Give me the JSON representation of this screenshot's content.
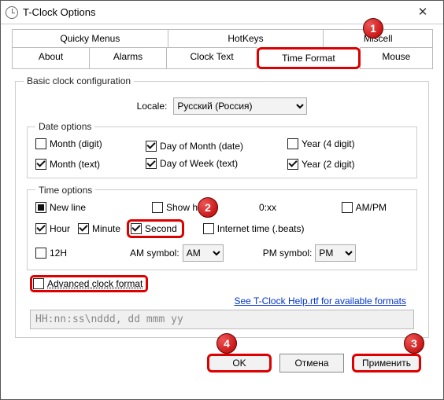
{
  "window": {
    "title": "T-Clock Options"
  },
  "tabs_top": [
    "Quicky Menus",
    "HotKeys",
    "Miscell"
  ],
  "tabs_bottom": [
    "About",
    "Alarms",
    "Clock Text",
    "Time Format",
    "Mouse"
  ],
  "group_basic": "Basic clock configuration",
  "locale_label": "Locale:",
  "locale_value": "Русский (Россия)",
  "group_date": "Date options",
  "date_options": {
    "month_digit": "Month (digit)",
    "month_text": "Month (text)",
    "day_of_month": "Day of Month (date)",
    "day_of_week": "Day of Week (text)",
    "year4": "Year (4 digit)",
    "year2": "Year (2 digit)"
  },
  "group_time": "Time options",
  "time_options": {
    "new_line": "New line",
    "show_hours": "Show h",
    "show_hours_suffix": "0:xx",
    "ampm": "AM/PM",
    "hour": "Hour",
    "minute": "Minute",
    "second": "Second",
    "internet_time": "Internet time (.beats)",
    "h12": "12H",
    "am_symbol_lbl": "AM symbol:",
    "am_symbol": "AM",
    "pm_symbol_lbl": "PM symbol:",
    "pm_symbol": "PM"
  },
  "advanced_label": "Advanced clock format",
  "help_link": "See T-Clock Help.rtf for available formats",
  "format_string": "HH:nn:ss\\nddd, dd mmm yy",
  "buttons": {
    "ok": "OK",
    "cancel": "Отмена",
    "apply": "Применить"
  },
  "callouts": {
    "1": "1",
    "2": "2",
    "3": "3",
    "4": "4"
  }
}
